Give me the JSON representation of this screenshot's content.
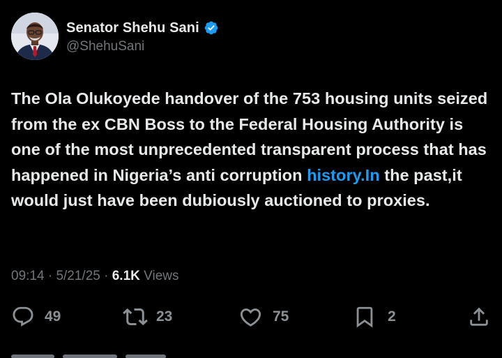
{
  "author": {
    "display_name": "Senator Shehu Sani",
    "handle": "@ShehuSani",
    "verified_icon": "verified-badge-icon"
  },
  "tweet": {
    "text_before_link": "The Ola Olukoyede handover of the 753 housing units seized from the ex CBN Boss to the Federal Housing Authority is one of the most unprecedented transparent process that has happened in Nigeria’s anti corruption ",
    "link_text": "history.In",
    "text_after_link": " the past,it would just have been dubiously auctioned to proxies."
  },
  "meta": {
    "time": "09:14",
    "separator": "·",
    "date": "5/21/25",
    "views_count": "6.1K",
    "views_label": "Views"
  },
  "actions": {
    "replies": "49",
    "reposts": "23",
    "likes": "75",
    "bookmarks": "2"
  },
  "colors": {
    "background": "#000000",
    "text_primary": "#e7e9ea",
    "text_secondary": "#71767b",
    "link": "#1d9bf0",
    "verified": "#1d9bf0"
  }
}
